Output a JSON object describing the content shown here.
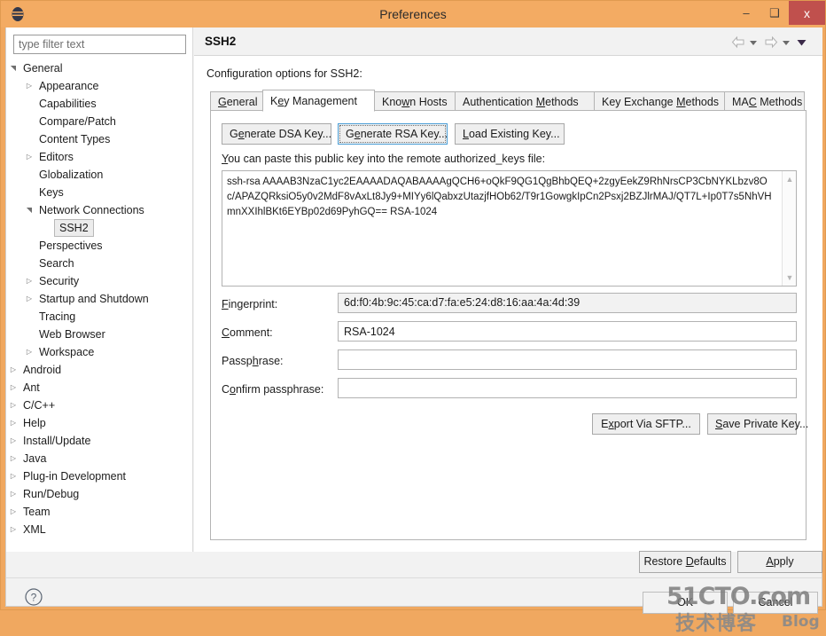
{
  "window": {
    "title": "Preferences",
    "app_icon": "eclipse-icon",
    "minimize_label": "–",
    "maximize_label": "❑",
    "close_label": "x"
  },
  "sidebar": {
    "filter_placeholder": "type filter text",
    "filter_value": "",
    "items": [
      {
        "label": "General",
        "indent": 0,
        "twisty": "expanded",
        "selected": false
      },
      {
        "label": "Appearance",
        "indent": 1,
        "twisty": "collapsed",
        "selected": false
      },
      {
        "label": "Capabilities",
        "indent": 1,
        "twisty": "none",
        "selected": false
      },
      {
        "label": "Compare/Patch",
        "indent": 1,
        "twisty": "none",
        "selected": false
      },
      {
        "label": "Content Types",
        "indent": 1,
        "twisty": "none",
        "selected": false
      },
      {
        "label": "Editors",
        "indent": 1,
        "twisty": "collapsed",
        "selected": false
      },
      {
        "label": "Globalization",
        "indent": 1,
        "twisty": "none",
        "selected": false
      },
      {
        "label": "Keys",
        "indent": 1,
        "twisty": "none",
        "selected": false
      },
      {
        "label": "Network Connections",
        "indent": 1,
        "twisty": "expanded",
        "selected": false
      },
      {
        "label": "SSH2",
        "indent": 2,
        "twisty": "none",
        "selected": true
      },
      {
        "label": "Perspectives",
        "indent": 1,
        "twisty": "none",
        "selected": false
      },
      {
        "label": "Search",
        "indent": 1,
        "twisty": "none",
        "selected": false
      },
      {
        "label": "Security",
        "indent": 1,
        "twisty": "collapsed",
        "selected": false
      },
      {
        "label": "Startup and Shutdown",
        "indent": 1,
        "twisty": "collapsed",
        "selected": false
      },
      {
        "label": "Tracing",
        "indent": 1,
        "twisty": "none",
        "selected": false
      },
      {
        "label": "Web Browser",
        "indent": 1,
        "twisty": "none",
        "selected": false
      },
      {
        "label": "Workspace",
        "indent": 1,
        "twisty": "collapsed",
        "selected": false
      },
      {
        "label": "Android",
        "indent": 0,
        "twisty": "collapsed",
        "selected": false
      },
      {
        "label": "Ant",
        "indent": 0,
        "twisty": "collapsed",
        "selected": false
      },
      {
        "label": "C/C++",
        "indent": 0,
        "twisty": "collapsed",
        "selected": false
      },
      {
        "label": "Help",
        "indent": 0,
        "twisty": "collapsed",
        "selected": false
      },
      {
        "label": "Install/Update",
        "indent": 0,
        "twisty": "collapsed",
        "selected": false
      },
      {
        "label": "Java",
        "indent": 0,
        "twisty": "collapsed",
        "selected": false
      },
      {
        "label": "Plug-in Development",
        "indent": 0,
        "twisty": "collapsed",
        "selected": false
      },
      {
        "label": "Run/Debug",
        "indent": 0,
        "twisty": "collapsed",
        "selected": false
      },
      {
        "label": "Team",
        "indent": 0,
        "twisty": "collapsed",
        "selected": false
      },
      {
        "label": "XML",
        "indent": 0,
        "twisty": "collapsed",
        "selected": false
      }
    ]
  },
  "page": {
    "title": "SSH2",
    "description": "Configuration options for SSH2:",
    "nav": {
      "back_icon": "arrow-left-icon",
      "back_menu_icon": "caret-down-icon",
      "forward_icon": "arrow-right-icon",
      "forward_menu_icon": "caret-down-icon",
      "menu_icon": "caret-down-filled-icon"
    }
  },
  "tabs": [
    {
      "label": "General",
      "mnemonic": "G",
      "active": false
    },
    {
      "label": "Key Management",
      "mnemonic": "e",
      "active": true
    },
    {
      "label": "Known Hosts",
      "mnemonic": "w",
      "active": false
    },
    {
      "label": "Authentication Methods",
      "mnemonic": "M",
      "active": false
    },
    {
      "label": "Key Exchange Methods",
      "mnemonic": "M",
      "active": false
    },
    {
      "label": "MAC Methods",
      "mnemonic": "C",
      "active": false
    }
  ],
  "key_management": {
    "buttons": {
      "generate_dsa": "Generate DSA Key...",
      "generate_rsa": "Generate RSA Key...",
      "load_existing": "Load Existing Key...",
      "export_sftp": "Export Via SFTP...",
      "save_private": "Save Private Key...",
      "focused": "generate_rsa"
    },
    "paste_label": "You can paste this public key into the remote authorized_keys file:",
    "public_key": "ssh-rsa AAAAB3NzaC1yc2EAAAADAQABAAAAgQCH6+oQkF9QG1QgBhbQEQ+2zgyEekZ9RhNrsCP3CbNYKLbzv8Oc/APAZQRksiO5y0v2MdF8vAxLt8Jy9+MIYy6lQabxzUtazjfHOb62/T9r1GowgkIpCn2Psxj2BZJlrMAJ/QT7L+Ip0T7s5NhVHmnXXIhlBKt6EYBp02d69PyhGQ== RSA-1024",
    "fields": {
      "fingerprint_label": "Fingerprint:",
      "fingerprint_value": "6d:f0:4b:9c:45:ca:d7:fa:e5:24:d8:16:aa:4a:4d:39",
      "comment_label": "Comment:",
      "comment_value": "RSA-1024",
      "passphrase_label": "Passphrase:",
      "passphrase_value": "",
      "confirm_label": "Confirm passphrase:",
      "confirm_value": ""
    },
    "scrollbar": {
      "up_icon": "chevron-up-icon",
      "down_icon": "chevron-down-icon"
    }
  },
  "footer": {
    "restore_defaults": "Restore Defaults",
    "apply": "Apply",
    "ok": "OK",
    "cancel": "Cancel",
    "help_icon": "question-mark-icon"
  },
  "watermark": {
    "main": "51CTO.com",
    "cn": "技术博客",
    "blog": "Blog"
  },
  "colors": {
    "titlebar": "#f3ab63",
    "close_button": "#c0504d",
    "focus_border": "#4b9ed6",
    "panel_bg": "#f2f2f2"
  }
}
